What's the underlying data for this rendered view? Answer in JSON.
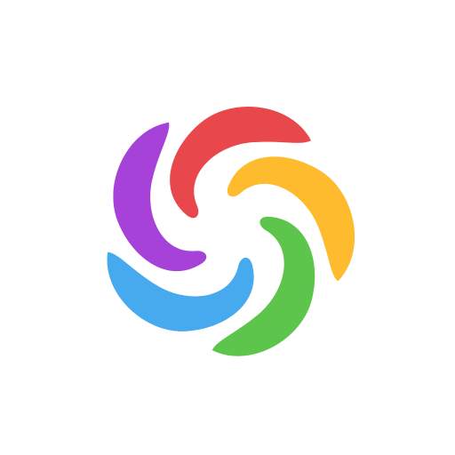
{
  "logo": {
    "icon": "swirl-pinwheel-logo-icon",
    "background": "#ffffff",
    "petals": [
      {
        "name": "red",
        "color": "#E8474B"
      },
      {
        "name": "yellow",
        "color": "#FDBB2D"
      },
      {
        "name": "green",
        "color": "#5DC54B"
      },
      {
        "name": "blue",
        "color": "#47AAEF"
      },
      {
        "name": "purple",
        "color": "#A742D9"
      }
    ]
  }
}
